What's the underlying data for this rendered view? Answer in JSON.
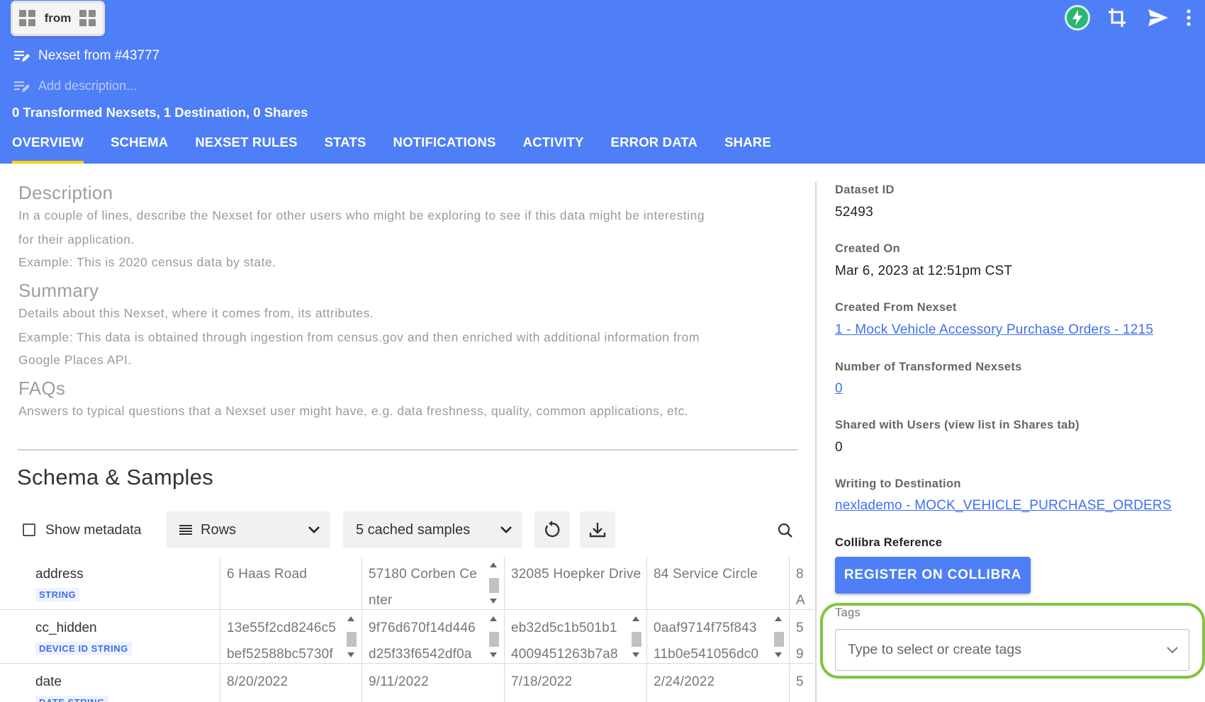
{
  "header": {
    "chip_label": "from",
    "title": "Nexset from #43777",
    "description_placeholder": "Add description...",
    "counts": "0 Transformed Nexsets, 1 Destination, 0 Shares",
    "tabs": [
      {
        "label": "OVERVIEW",
        "active": true
      },
      {
        "label": "SCHEMA"
      },
      {
        "label": "NEXSET RULES"
      },
      {
        "label": "STATS"
      },
      {
        "label": "NOTIFICATIONS"
      },
      {
        "label": "ACTIVITY"
      },
      {
        "label": "ERROR DATA"
      },
      {
        "label": "SHARE"
      }
    ],
    "icons": [
      "grid-icon",
      "bolt-icon",
      "crop-icon",
      "send-icon",
      "more-vert-icon"
    ]
  },
  "overview": {
    "description": {
      "heading": "Description",
      "lines": [
        "In a couple of lines, describe the Nexset for other users who might be exploring to see if this data might be interesting",
        "for their application.",
        "Example: This is 2020 census data by state."
      ]
    },
    "summary": {
      "heading": "Summary",
      "lines": [
        "Details about this Nexset, where it comes from, its attributes.",
        "Example: This data is obtained through ingestion from census.gov and then enriched with additional information from",
        "Google Places API."
      ]
    },
    "faqs": {
      "heading": "FAQs",
      "lines": [
        "Answers to typical questions that a Nexset user might have, e.g. data freshness, quality, common applications, etc."
      ]
    }
  },
  "schema": {
    "title": "Schema & Samples",
    "show_metadata_label": "Show metadata",
    "view_select": "Rows",
    "samples_select": "5 cached samples",
    "rows": [
      {
        "field": "address",
        "type": "STRING",
        "values": [
          "6 Haas Road",
          "57180 Corben Ce\nnter",
          "32085 Hoepker Drive",
          "84 Service Circle",
          "8\nA"
        ]
      },
      {
        "field": "cc_hidden",
        "type": "DEVICE ID STRING",
        "values": [
          "13e55f2cd8246c5\nbef52588bc5730f",
          "9f76d670f14d446\nd25f33f6542df0a",
          "eb32d5c1b501b1\n4009451263b7a8",
          "0aaf9714f75f843\n11b0e541056dc0",
          "5\n9"
        ]
      },
      {
        "field": "date",
        "type": "DATE STRING",
        "values": [
          "8/20/2022",
          "9/11/2022",
          "7/18/2022",
          "2/24/2022",
          "5"
        ]
      }
    ]
  },
  "details": {
    "dataset_id_label": "Dataset ID",
    "dataset_id": "52493",
    "created_on_label": "Created On",
    "created_on": "Mar 6, 2023 at 12:51pm CST",
    "created_from_label": "Created From Nexset",
    "created_from": "1 - Mock Vehicle Accessory Purchase Orders - 1215",
    "transformed_label": "Number of Transformed Nexsets",
    "transformed": "0",
    "shared_label": "Shared with Users (view list in Shares tab)",
    "shared": "0",
    "destination_label": "Writing to Destination",
    "destination": "nexlademo - MOCK_VEHICLE_PURCHASE_ORDERS",
    "collibra_label": "Collibra Reference",
    "collibra_button": "REGISTER ON COLLIBRA",
    "tags_label": "Tags",
    "tags_placeholder": "Type to select or create tags"
  },
  "colors": {
    "header_bg": "#4f7ff7",
    "active_tab_indicator": "#ffd400",
    "link": "#3d6ff0",
    "highlight_ring": "#84c341",
    "bolt": "#2bb673"
  }
}
